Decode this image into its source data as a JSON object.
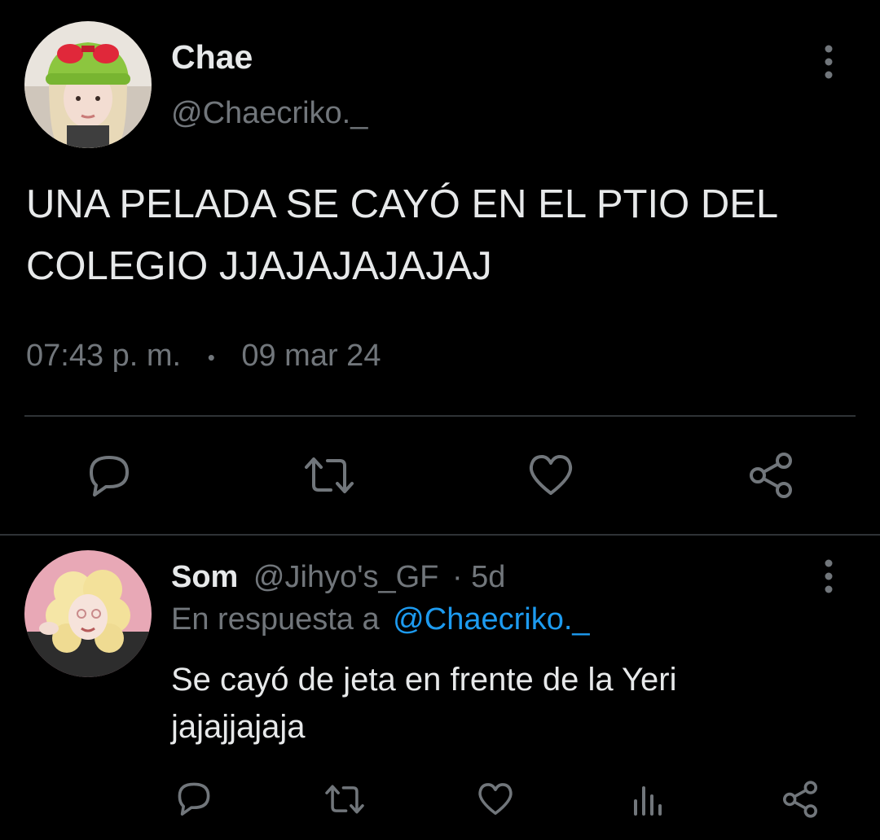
{
  "tweet": {
    "author": {
      "name": "Chae",
      "handle": "@Chaecriko._"
    },
    "text_line1": "UNA PELADA SE CAYÓ EN EL PTIO DEL",
    "text_line2": "COLEGIO JJAJAJAJAJAJ",
    "time": "07:43 p. m.",
    "separator": "•",
    "date": "09 mar 24",
    "actions": [
      "reply-icon",
      "retweet-icon",
      "like-icon",
      "share-icon"
    ]
  },
  "reply": {
    "author": {
      "name": "Som",
      "handle": "@Jihyo's_GF",
      "age": "· 5d"
    },
    "in_reply_to_prefix": "En respuesta a",
    "in_reply_to_handle": "@Chaecriko._",
    "text_line1": "Se cayó de jeta en frente de la Yeri",
    "text_line2": "jajajjajaja",
    "actions": [
      "reply-icon",
      "retweet-icon",
      "like-icon",
      "views-icon",
      "share-icon"
    ]
  },
  "colors": {
    "background": "#000000",
    "text": "#e7e9ea",
    "muted": "#71767b",
    "link": "#1d9bf0",
    "divider": "#2f3336"
  }
}
